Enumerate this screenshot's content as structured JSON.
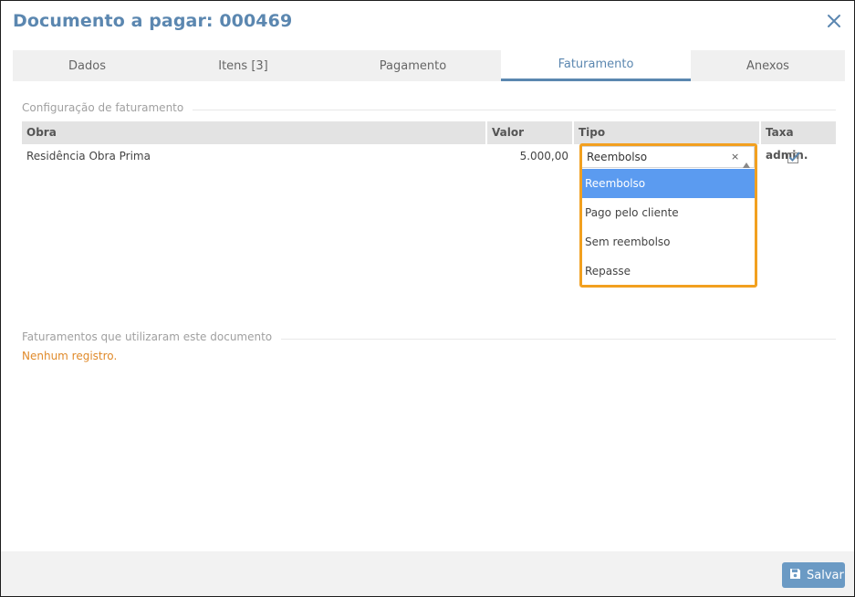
{
  "window": {
    "title": "Documento a pagar: 000469"
  },
  "tabs": [
    {
      "label": "Dados"
    },
    {
      "label": "Itens [3]"
    },
    {
      "label": "Pagamento"
    },
    {
      "label": "Faturamento",
      "active": true
    },
    {
      "label": "Anexos"
    }
  ],
  "billing_config": {
    "heading": "Configuração de faturamento",
    "columns": [
      "Obra",
      "Valor",
      "Tipo",
      "Taxa admin."
    ],
    "rows": [
      {
        "obra": "Residência Obra Prima",
        "valor": "5.000,00",
        "tipo": "Reembolso",
        "taxa_admin": true
      }
    ],
    "tipo_options": [
      "Reembolso",
      "Pago pelo cliente",
      "Sem reembolso",
      "Repasse"
    ],
    "clear_symbol": "×"
  },
  "billings_using": {
    "heading": "Faturamentos que utilizaram este documento",
    "empty_text": "Nenhum registro."
  },
  "footer": {
    "save_label": "Salvar"
  },
  "colors": {
    "accent": "#5b87b0",
    "highlight": "#f2a01f",
    "selected_option": "#5b9bf0",
    "empty_text": "#e08a2a"
  }
}
